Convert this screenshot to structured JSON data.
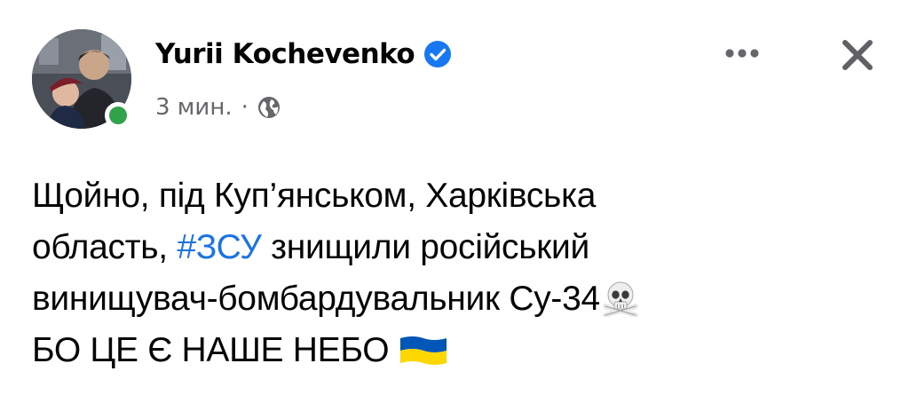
{
  "post": {
    "author": {
      "name": "Yurii Kochevenko",
      "verified": true,
      "online": true,
      "avatar_description_icon": "profile-photo"
    },
    "timestamp": "3 мин.",
    "separator": "·",
    "audience_icon": "globe-icon",
    "actions": {
      "more_icon": "more-options-icon",
      "close_icon": "close-icon"
    },
    "body": {
      "line1": "Щойно, під Куп’янськом, Харківська",
      "line2_before": "область, ",
      "hashtag": "#ЗСУ",
      "line2_after": " знищили російський",
      "line3": "винищувач-бомбардувальник Су-34",
      "line3_emoji": "skull-crossbones-emoji",
      "line4": "БО ЦЕ Є НАШЕ НЕБО ",
      "line4_emoji": "ukraine-flag-emoji"
    }
  },
  "colors": {
    "text": "#050505",
    "meta": "#65676b",
    "link": "#1b74e4",
    "verified": "#1877f2",
    "online": "#31a24c",
    "flag_blue": "#0057b7",
    "flag_yellow": "#ffd700"
  }
}
